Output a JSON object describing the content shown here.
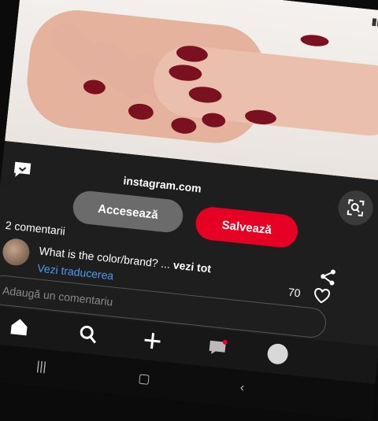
{
  "status": {
    "battery": "76"
  },
  "pin": {
    "domain": "instagram.com",
    "visit_label": "Accesează",
    "save_label": "Salvează"
  },
  "comments": {
    "count_label": "2 comentarii",
    "text": "What is the color/brand? ...",
    "more_label": "vezi tot",
    "translate_label": "Vezi traducerea",
    "likes": "70",
    "input_placeholder": "Adaugă un comentariu"
  },
  "colors": {
    "accent": "#e60023",
    "nail": "#7a1020",
    "link": "#4f9bf0"
  },
  "icons": {
    "top": "back-icon",
    "domain": "message-icon",
    "lens": "visual-search-icon",
    "share": "share-icon",
    "heart": "heart-icon",
    "nav": [
      "home-icon",
      "search-icon",
      "add-icon",
      "messages-icon",
      "profile-avatar"
    ],
    "system": [
      "recent-apps-icon",
      "home-square-icon",
      "back-system-icon"
    ]
  }
}
